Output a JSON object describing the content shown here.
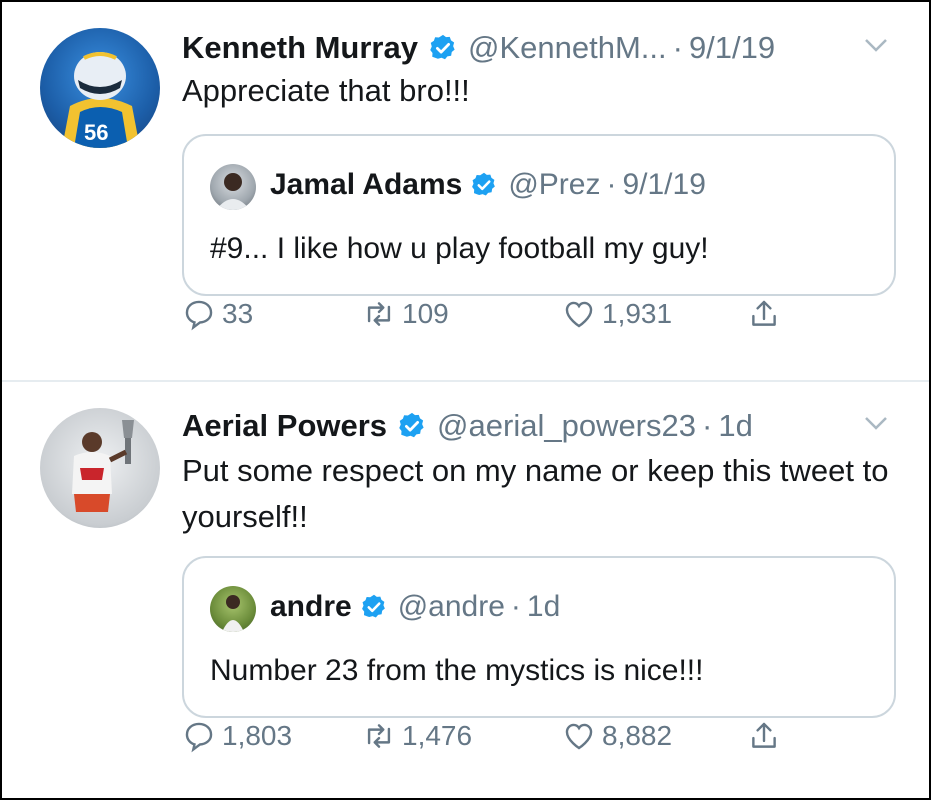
{
  "colors": {
    "accent": "#1da1f2",
    "secondary_text": "#657786",
    "border": "#ccd6dd"
  },
  "tweets": [
    {
      "author": "Kenneth Murray",
      "handle": "@KennethM...",
      "date": "9/1/19",
      "separator": "·",
      "text": "Appreciate that bro!!!",
      "avatar_icon": "football-player-avatar",
      "quote": {
        "author": "Jamal Adams",
        "handle": "@Prez",
        "date": "9/1/19",
        "text": "#9... I like how u play football my guy!"
      },
      "replies": "33",
      "retweets": "109",
      "likes": "1,931"
    },
    {
      "author": "Aerial Powers",
      "handle": "@aerial_powers23",
      "date": "1d",
      "separator": "·",
      "text": "Put some respect on my name or keep this tweet to yourself!!",
      "avatar_icon": "athlete-with-trophy-avatar",
      "quote": {
        "author": "andre",
        "handle": "@andre",
        "date": "1d",
        "text": "Number 23 from the mystics is nice!!!"
      },
      "replies": "1,803",
      "retweets": "1,476",
      "likes": "8,882"
    }
  ]
}
